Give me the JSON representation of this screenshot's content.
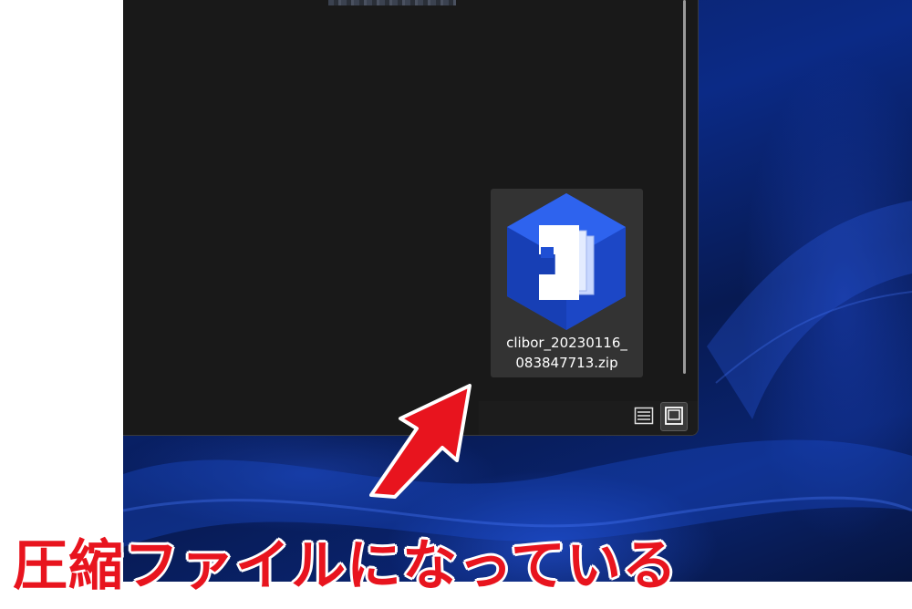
{
  "explorer": {
    "file": {
      "name_line1": "clibor_20230116_",
      "name_line2": "083847713.zip",
      "icon": "zip-archive-icon"
    },
    "view_buttons": {
      "details_icon": "details-view-icon",
      "large_icon": "large-icons-view-icon"
    }
  },
  "annotation": {
    "caption": "圧縮ファイルになっている",
    "arrow_icon": "red-arrow-icon",
    "color": "#e8141e"
  },
  "colors": {
    "explorer_bg": "#191919",
    "item_selected": "#333333",
    "desktop_accent": "#0b2a86"
  }
}
